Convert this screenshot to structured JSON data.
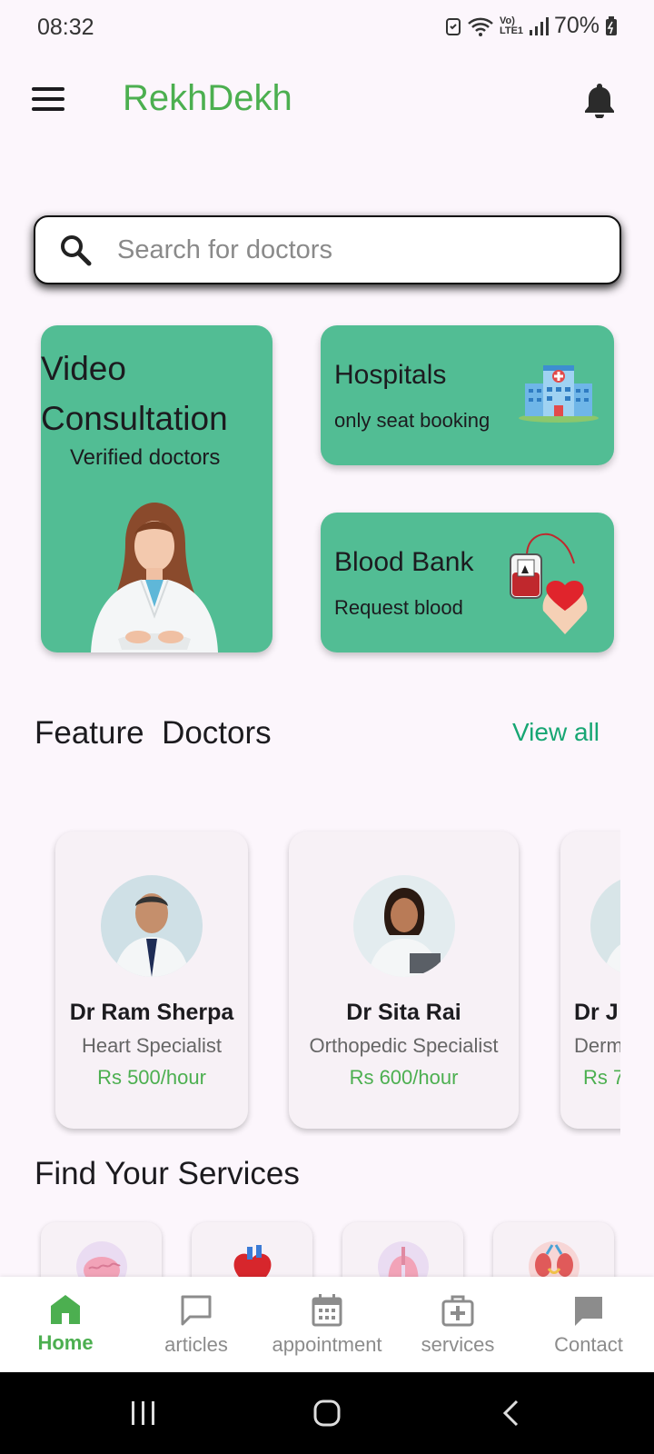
{
  "status_bar": {
    "time": "08:32",
    "network": "Vo) LTE1",
    "battery": "70%"
  },
  "app_bar": {
    "title": "RekhDekh"
  },
  "search": {
    "placeholder": "Search for doctors"
  },
  "quick_cards": {
    "video": {
      "title_line1": "Video",
      "title_line2": "Consultation",
      "subtitle": "Verified doctors"
    },
    "hospitals": {
      "title": "Hospitals",
      "subtitle": "only seat booking"
    },
    "blood_bank": {
      "title": "Blood Bank",
      "subtitle": "Request blood"
    }
  },
  "featured": {
    "title": "Feature  Doctors",
    "view_all": "View all",
    "doctors": [
      {
        "name": "Dr Ram Sherpa",
        "specialty": "Heart Specialist",
        "price": "Rs 500/hour"
      },
      {
        "name": "Dr Sita Rai",
        "specialty": "Orthopedic Specialist",
        "price": "Rs 600/hour"
      },
      {
        "name": "Dr J",
        "specialty": "Derm",
        "price": "Rs 7"
      }
    ]
  },
  "services": {
    "title": "Find Your Services",
    "items": [
      {
        "icon": "brain-icon"
      },
      {
        "icon": "heart-organ-icon"
      },
      {
        "icon": "lungs-icon"
      },
      {
        "icon": "kidney-icon"
      }
    ]
  },
  "bottom_nav": {
    "items": [
      {
        "label": "Home",
        "icon": "home-icon",
        "active": true
      },
      {
        "label": "articles",
        "icon": "chat-bubble-icon"
      },
      {
        "label": "appointment",
        "icon": "calendar-icon"
      },
      {
        "label": "services",
        "icon": "medical-bag-icon"
      },
      {
        "label": "Contact",
        "icon": "message-icon"
      }
    ]
  },
  "colors": {
    "brand_green": "#4caf50",
    "card_green": "#52bd94",
    "link_green": "#17a673",
    "background": "#fcf6fc"
  }
}
